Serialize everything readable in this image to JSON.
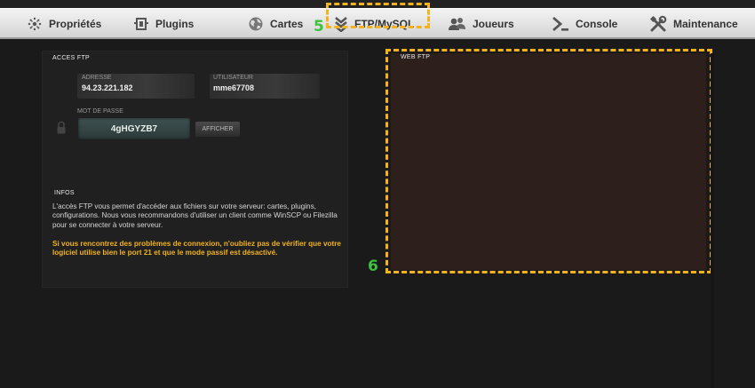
{
  "nav": {
    "tabs": [
      {
        "label": "Propriétés",
        "icon": "gear-icon"
      },
      {
        "label": "Plugins",
        "icon": "plugin-icon"
      },
      {
        "label": "Cartes",
        "icon": "globe-icon"
      },
      {
        "label": "FTP/MySQL",
        "icon": "chevrons-down-icon",
        "active": true
      },
      {
        "label": "Joueurs",
        "icon": "users-icon"
      },
      {
        "label": "Console",
        "icon": "terminal-icon"
      },
      {
        "label": "Maintenance",
        "icon": "tools-icon"
      }
    ]
  },
  "annotations": {
    "step5": "5",
    "step6": "6"
  },
  "ftp_access": {
    "title": "ACCES FTP",
    "address_label": "ADRESSE",
    "address_value": "94.23.221.182",
    "user_label": "UTILISATEUR",
    "user_value": "mme67708",
    "password_label": "MOT DE PASSE",
    "password_value": "4gHGYZB7",
    "show_button": "AFFICHER"
  },
  "infos": {
    "title": "INFOS",
    "text": "L'accès FTP vous permet d'accéder aux fichiers sur votre serveur: cartes, plugins, configurations. Nous vous recommandons d'utiliser un client comme WinSCP ou Filezilla pour se connecter à votre serveur.",
    "warning": "Si vous rencontrez des problèmes de connexion, n'oubliez pas de vérifier que votre logiciel utilise bien le port 21 et que le mode passif est désactivé."
  },
  "webftp": {
    "title": "WEB FTP"
  },
  "colors": {
    "highlight": "#f4b21d",
    "step_label": "#3cc23c",
    "warning_text": "#f0b21e"
  }
}
